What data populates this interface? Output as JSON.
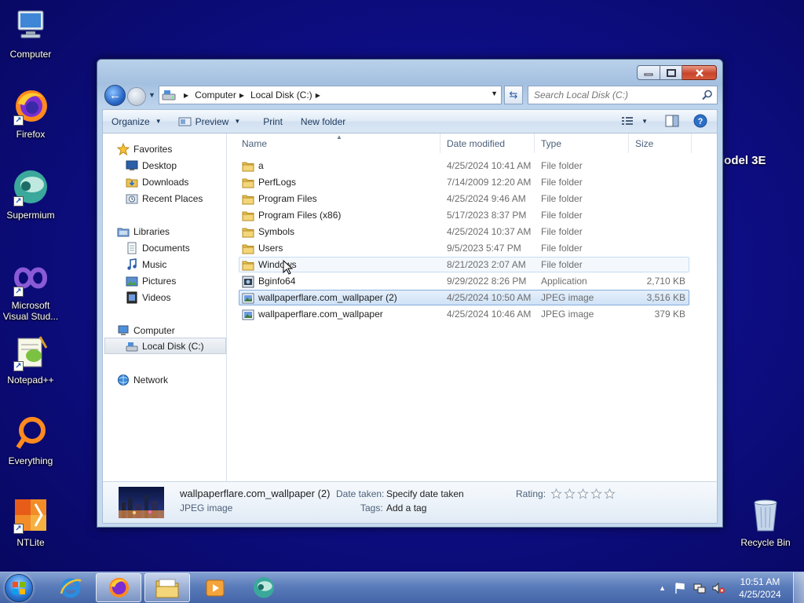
{
  "desktop": {
    "icons": [
      {
        "label": "Computer"
      },
      {
        "label": "Firefox"
      },
      {
        "label": "Supermium"
      },
      {
        "label": "Microsoft Visual Stud..."
      },
      {
        "label": "Notepad++"
      },
      {
        "label": "Everything"
      },
      {
        "label": "NTLite"
      },
      {
        "label": "Recycle Bin"
      }
    ],
    "background_text": "lodel 3E",
    "bg_color": "#0e0e86"
  },
  "window": {
    "controls": {
      "minimize": "minimize-icon",
      "maximize": "maximize-icon",
      "close": "close-icon"
    },
    "breadcrumb": [
      "Computer",
      "Local Disk (C:)"
    ],
    "search_placeholder": "Search Local Disk (C:)",
    "toolbar": {
      "organize": "Organize",
      "preview": "Preview",
      "print": "Print",
      "new_folder": "New folder"
    },
    "nav": {
      "favorites": "Favorites",
      "desktop": "Desktop",
      "downloads": "Downloads",
      "recent_places": "Recent Places",
      "libraries": "Libraries",
      "documents": "Documents",
      "music": "Music",
      "pictures": "Pictures",
      "videos": "Videos",
      "computer": "Computer",
      "local_disk": "Local Disk (C:)",
      "network": "Network"
    },
    "columns": {
      "name": "Name",
      "date": "Date modified",
      "type": "Type",
      "size": "Size"
    },
    "files": [
      {
        "name": "a",
        "date": "4/25/2024 10:41 AM",
        "type": "File folder",
        "size": ""
      },
      {
        "name": "PerfLogs",
        "date": "7/14/2009 12:20 AM",
        "type": "File folder",
        "size": ""
      },
      {
        "name": "Program Files",
        "date": "4/25/2024 9:46 AM",
        "type": "File folder",
        "size": ""
      },
      {
        "name": "Program Files (x86)",
        "date": "5/17/2023 8:37 PM",
        "type": "File folder",
        "size": ""
      },
      {
        "name": "Symbols",
        "date": "4/25/2024 10:37 AM",
        "type": "File folder",
        "size": ""
      },
      {
        "name": "Users",
        "date": "9/5/2023 5:47 PM",
        "type": "File folder",
        "size": ""
      },
      {
        "name": "Windows",
        "date": "8/21/2023 2:07 AM",
        "type": "File folder",
        "size": ""
      },
      {
        "name": "Bginfo64",
        "date": "9/29/2022 8:26 PM",
        "type": "Application",
        "size": "2,710 KB"
      },
      {
        "name": "wallpaperflare.com_wallpaper (2)",
        "date": "4/25/2024 10:50 AM",
        "type": "JPEG image",
        "size": "3,516 KB"
      },
      {
        "name": "wallpaperflare.com_wallpaper",
        "date": "4/25/2024 10:46 AM",
        "type": "JPEG image",
        "size": "379 KB"
      }
    ],
    "details": {
      "filename": "wallpaperflare.com_wallpaper (2)",
      "filetype": "JPEG image",
      "date_taken_label": "Date taken:",
      "date_taken_value": "Specify date taken",
      "tags_label": "Tags:",
      "tags_value": "Add a tag",
      "rating_label": "Rating:"
    }
  },
  "taskbar": {
    "time": "10:51 AM",
    "date": "4/25/2024"
  }
}
